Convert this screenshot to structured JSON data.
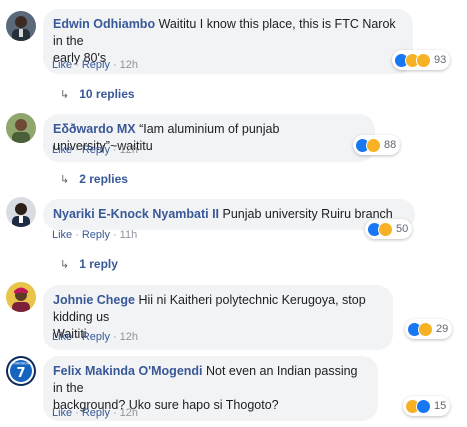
{
  "comments": [
    {
      "author": "Edwin Odhiambo",
      "text_line1": " Waititu I know this place, this is FTC Narok in the",
      "text_line2": "early 80's",
      "actions": {
        "like": "Like",
        "reply": "Reply",
        "time": "12h"
      },
      "reaction_count": "93",
      "replies_label": "10 replies"
    },
    {
      "author": "Eδðwardo MX",
      "text_line1": " “Iam aluminium of punjab university”~waititu",
      "actions": {
        "like": "Like",
        "reply": "Reply",
        "time": "12h"
      },
      "reaction_count": "88",
      "replies_label": "2 replies"
    },
    {
      "author": "Nyariki E-Knock Nyambati II",
      "text_line1": " Punjab university Ruiru branch",
      "actions": {
        "like": "Like",
        "reply": "Reply",
        "time": "11h"
      },
      "reaction_count": "50",
      "replies_label": "1 reply"
    },
    {
      "author": "Johnie Chege",
      "text_line1": " Hii ni Kaitheri polytechnic Kerugoya, stop kidding us",
      "text_line2": "Waititi",
      "actions": {
        "like": "Like",
        "reply": "Reply",
        "time": "12h"
      },
      "reaction_count": "29"
    },
    {
      "author": "Felix Makinda O'Mogendi",
      "text_line1": " Not even an Indian passing in the",
      "text_line2": "background? Uko sure hapo si Thogoto?",
      "actions": {
        "like": "Like",
        "reply": "Reply",
        "time": "12h"
      },
      "reaction_count": "15",
      "avatar_text": "7",
      "avatar_top_text": "MAKINDA"
    }
  ],
  "colors": {
    "link": "#385898",
    "bubble": "#f2f3f5",
    "like": "#1877f2",
    "haha": "#f7b125"
  },
  "icons": [
    "like-reaction-icon",
    "haha-reaction-icon",
    "wow-reaction-icon",
    "reply-arrow-icon"
  ]
}
